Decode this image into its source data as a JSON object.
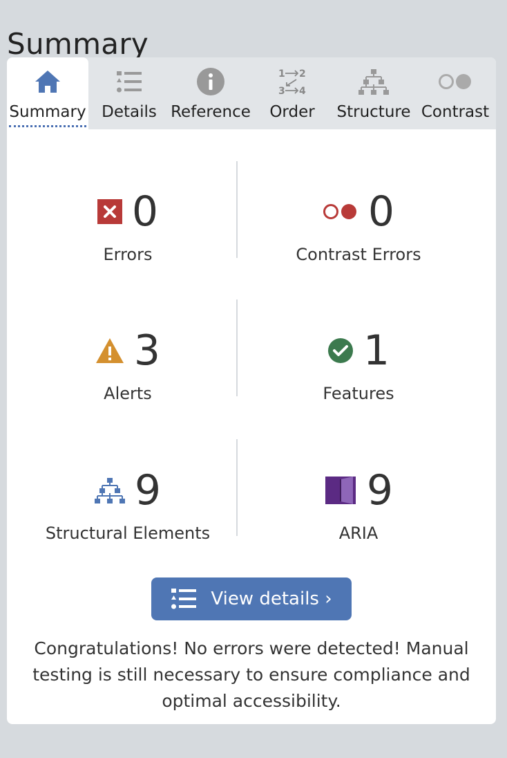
{
  "page": {
    "title": "Summary"
  },
  "tabs": [
    {
      "label": "Summary",
      "icon": "home-icon",
      "active": true
    },
    {
      "label": "Details",
      "icon": "list-icon",
      "active": false
    },
    {
      "label": "Reference",
      "icon": "info-icon",
      "active": false
    },
    {
      "label": "Order",
      "icon": "order-icon",
      "active": false
    },
    {
      "label": "Structure",
      "icon": "structure-icon",
      "active": false
    },
    {
      "label": "Contrast",
      "icon": "contrast-icon",
      "active": false
    }
  ],
  "stats": {
    "errors": {
      "value": "0",
      "label": "Errors",
      "icon": "error-x-icon",
      "color": "#c0392b"
    },
    "contrast_errors": {
      "value": "0",
      "label": "Contrast Errors",
      "icon": "contrast-error-icon",
      "color": "#c0392b"
    },
    "alerts": {
      "value": "3",
      "label": "Alerts",
      "icon": "alert-triangle-icon",
      "color": "#d4902f"
    },
    "features": {
      "value": "1",
      "label": "Features",
      "icon": "feature-check-icon",
      "color": "#3c7a4e"
    },
    "structural": {
      "value": "9",
      "label": "Structural Elements",
      "icon": "structure-icon",
      "color": "#4f76b4"
    },
    "aria": {
      "value": "9",
      "label": "ARIA",
      "icon": "aria-icon",
      "color": "#5b2a83"
    }
  },
  "button": {
    "label": "View details ›",
    "icon": "list-icon"
  },
  "message": "Congratulations! No errors were detected! Manual testing is still necessary to ensure compliance and optimal accessibility.",
  "colors": {
    "accent": "#4f76b4",
    "background": "#d6dade",
    "tabbar": "#e2e5e8"
  }
}
